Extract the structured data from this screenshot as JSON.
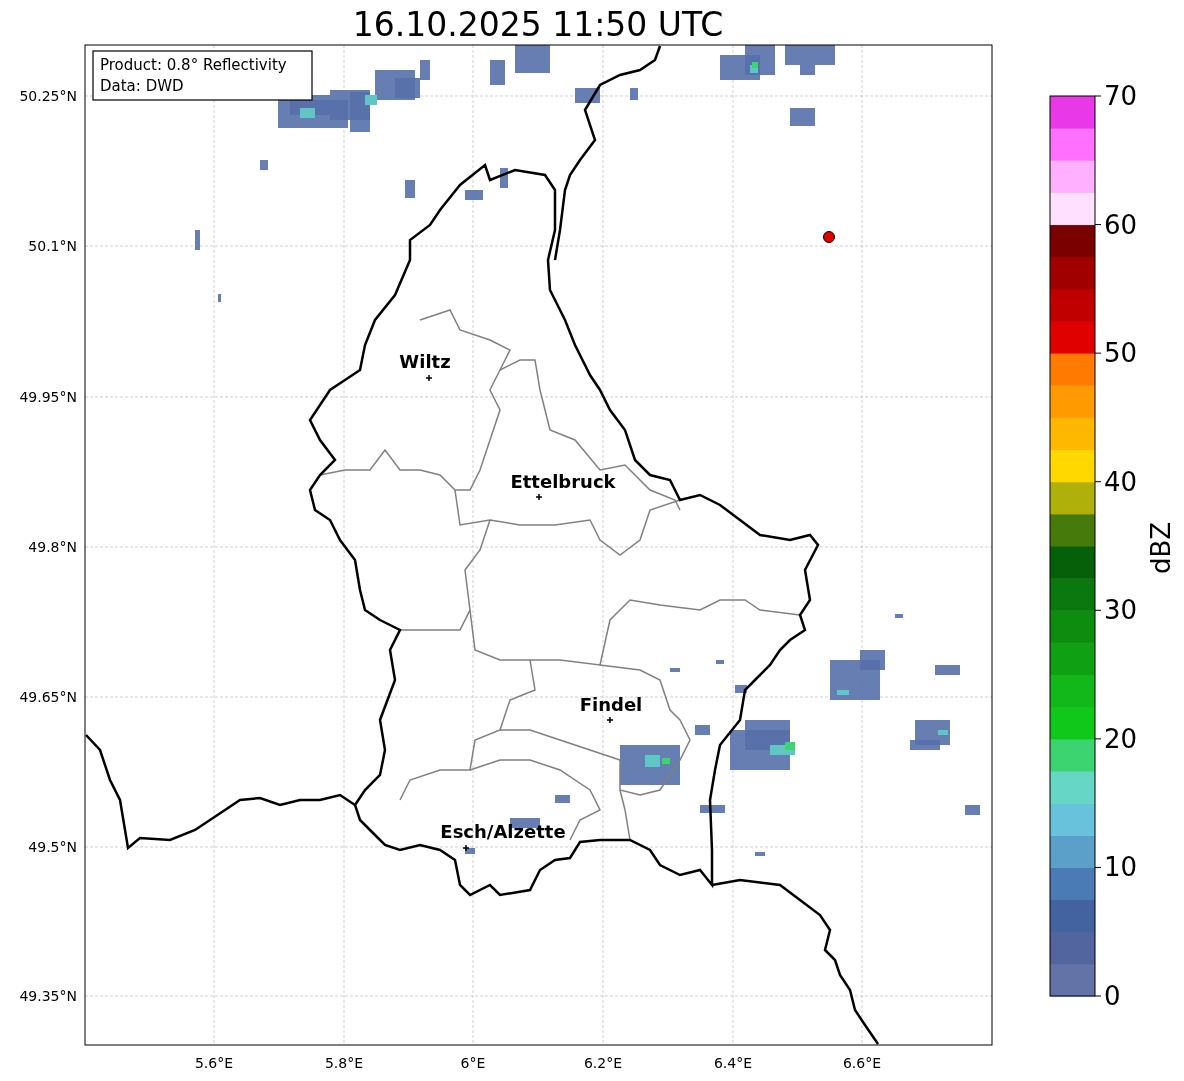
{
  "title": "16.10.2025 11:50 UTC",
  "info_box": [
    "Product: 0.8° Reflectivity",
    "Data: DWD"
  ],
  "lat_ticks": [
    "50.25°N",
    "50.1°N",
    "49.95°N",
    "49.8°N",
    "49.65°N",
    "49.5°N",
    "49.35°N"
  ],
  "lon_ticks": [
    "5.6°E",
    "5.8°E",
    "6°E",
    "6.2°E",
    "6.4°E",
    "6.6°E"
  ],
  "cities": [
    {
      "label": "Wiltz"
    },
    {
      "label": "Ettelbruck"
    },
    {
      "label": "Findel"
    },
    {
      "label": "Esch/Alzette"
    }
  ],
  "colorbar": {
    "label": "dBZ",
    "ticks": [
      "70",
      "60",
      "50",
      "40",
      "30",
      "20",
      "10",
      "0"
    ]
  }
}
